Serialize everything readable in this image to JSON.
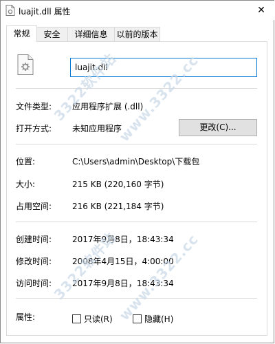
{
  "window": {
    "title": "luajit.dll 属性",
    "close_glyph": "✕"
  },
  "tabs": [
    {
      "label": "常规",
      "active": true
    },
    {
      "label": "安全",
      "active": false
    },
    {
      "label": "详细信息",
      "active": false
    },
    {
      "label": "以前的版本",
      "active": false
    }
  ],
  "general": {
    "file_name": "luajit.dll",
    "file_type_label": "文件类型:",
    "file_type_value": "应用程序扩展 (.dll)",
    "open_with_label": "打开方式:",
    "open_with_value": "未知应用程序",
    "change_button": "更改(C)...",
    "location_label": "位置:",
    "location_value": "C:\\Users\\admin\\Desktop\\下载包",
    "size_label": "大小:",
    "size_value": "215 KB (220,160 字节)",
    "size_on_disk_label": "占用空间:",
    "size_on_disk_value": "216 KB (221,184 字节)",
    "created_label": "创建时间:",
    "created_value": "2017年9月8日，18:43:34",
    "modified_label": "修改时间:",
    "modified_value": "2008年4月15日，4:00:00",
    "accessed_label": "访问时间:",
    "accessed_value": "2017年9月8日，18:43:34",
    "attributes_label": "属性:",
    "readonly_label": "只读(R)",
    "readonly_checked": false,
    "hidden_label": "隐藏(H)",
    "hidden_checked": false
  },
  "watermarks": [
    "3322软件站",
    "www.3322.cc",
    "3322软件站",
    "www.3322.cc"
  ]
}
